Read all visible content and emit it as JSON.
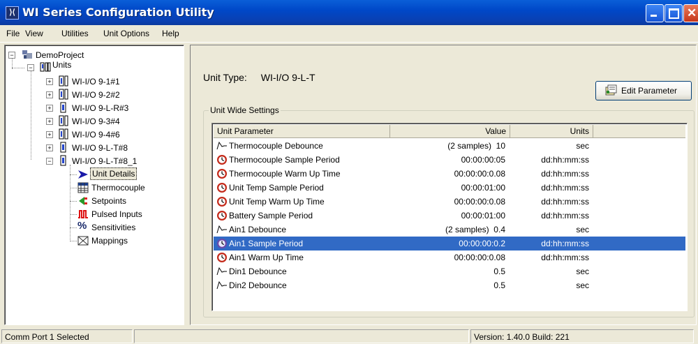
{
  "window": {
    "title": "WI Series Configuration Utility"
  },
  "menu": [
    "File",
    "View",
    "Utilities",
    "Unit Options",
    "Help"
  ],
  "tree": {
    "project": "DemoProject",
    "units_label": "Units",
    "units": [
      "WI-I/O 9-1#1",
      "WI-I/O 9-2#2",
      "WI-I/O 9-L-R#3",
      "WI-I/O 9-3#4",
      "WI-I/O 9-4#6",
      "WI-I/O 9-L-T#8",
      "WI-I/O 9-L-T#8_1"
    ],
    "children": [
      "Unit Details",
      "Thermocouple",
      "Setpoints",
      "Pulsed Inputs",
      "Sensitivities",
      "Mappings"
    ]
  },
  "main": {
    "unit_type_label": "Unit Type:",
    "unit_type_value": "WI-I/O 9-L-T",
    "edit_button": "Edit Parameter",
    "group_label": "Unit Wide Settings",
    "columns": [
      "Unit Parameter",
      "Value",
      "Units"
    ],
    "rows": [
      {
        "icon": "wave-icon",
        "param": "Thermocouple Debounce",
        "value": "(2 samples)  10",
        "units": "sec"
      },
      {
        "icon": "clock-icon",
        "param": "Thermocouple Sample Period",
        "value": "00:00:00:05",
        "units": "dd:hh:mm:ss"
      },
      {
        "icon": "clock-icon",
        "param": "Thermocouple Warm Up Time",
        "value": "00:00:00:0.08",
        "units": "dd:hh:mm:ss"
      },
      {
        "icon": "clock-icon",
        "param": "Unit Temp Sample Period",
        "value": "00:00:01:00",
        "units": "dd:hh:mm:ss"
      },
      {
        "icon": "clock-icon",
        "param": "Unit Temp Warm Up Time",
        "value": "00:00:00:0.08",
        "units": "dd:hh:mm:ss"
      },
      {
        "icon": "clock-icon",
        "param": "Battery Sample Period",
        "value": "00:00:01:00",
        "units": "dd:hh:mm:ss"
      },
      {
        "icon": "wave-icon",
        "param": "Ain1 Debounce",
        "value": "(2 samples)  0.4",
        "units": "sec"
      },
      {
        "icon": "clock-icon",
        "param": "Ain1 Sample Period",
        "value": "00:00:00:0.2",
        "units": "dd:hh:mm:ss"
      },
      {
        "icon": "clock-icon",
        "param": "Ain1 Warm Up Time",
        "value": "00:00:00:0.08",
        "units": "dd:hh:mm:ss"
      },
      {
        "icon": "wave-icon",
        "param": "Din1 Debounce",
        "value": "0.5",
        "units": "sec"
      },
      {
        "icon": "wave-icon",
        "param": "Din2 Debounce",
        "value": "0.5",
        "units": "sec"
      }
    ],
    "selected_row": 7
  },
  "status": {
    "left": "Comm Port 1 Selected",
    "middle": "",
    "right": "Version: 1.40.0 Build: 221"
  },
  "colors": {
    "titlebar": "#0048c8",
    "selection": "#316ac5",
    "face": "#ece9d8"
  }
}
